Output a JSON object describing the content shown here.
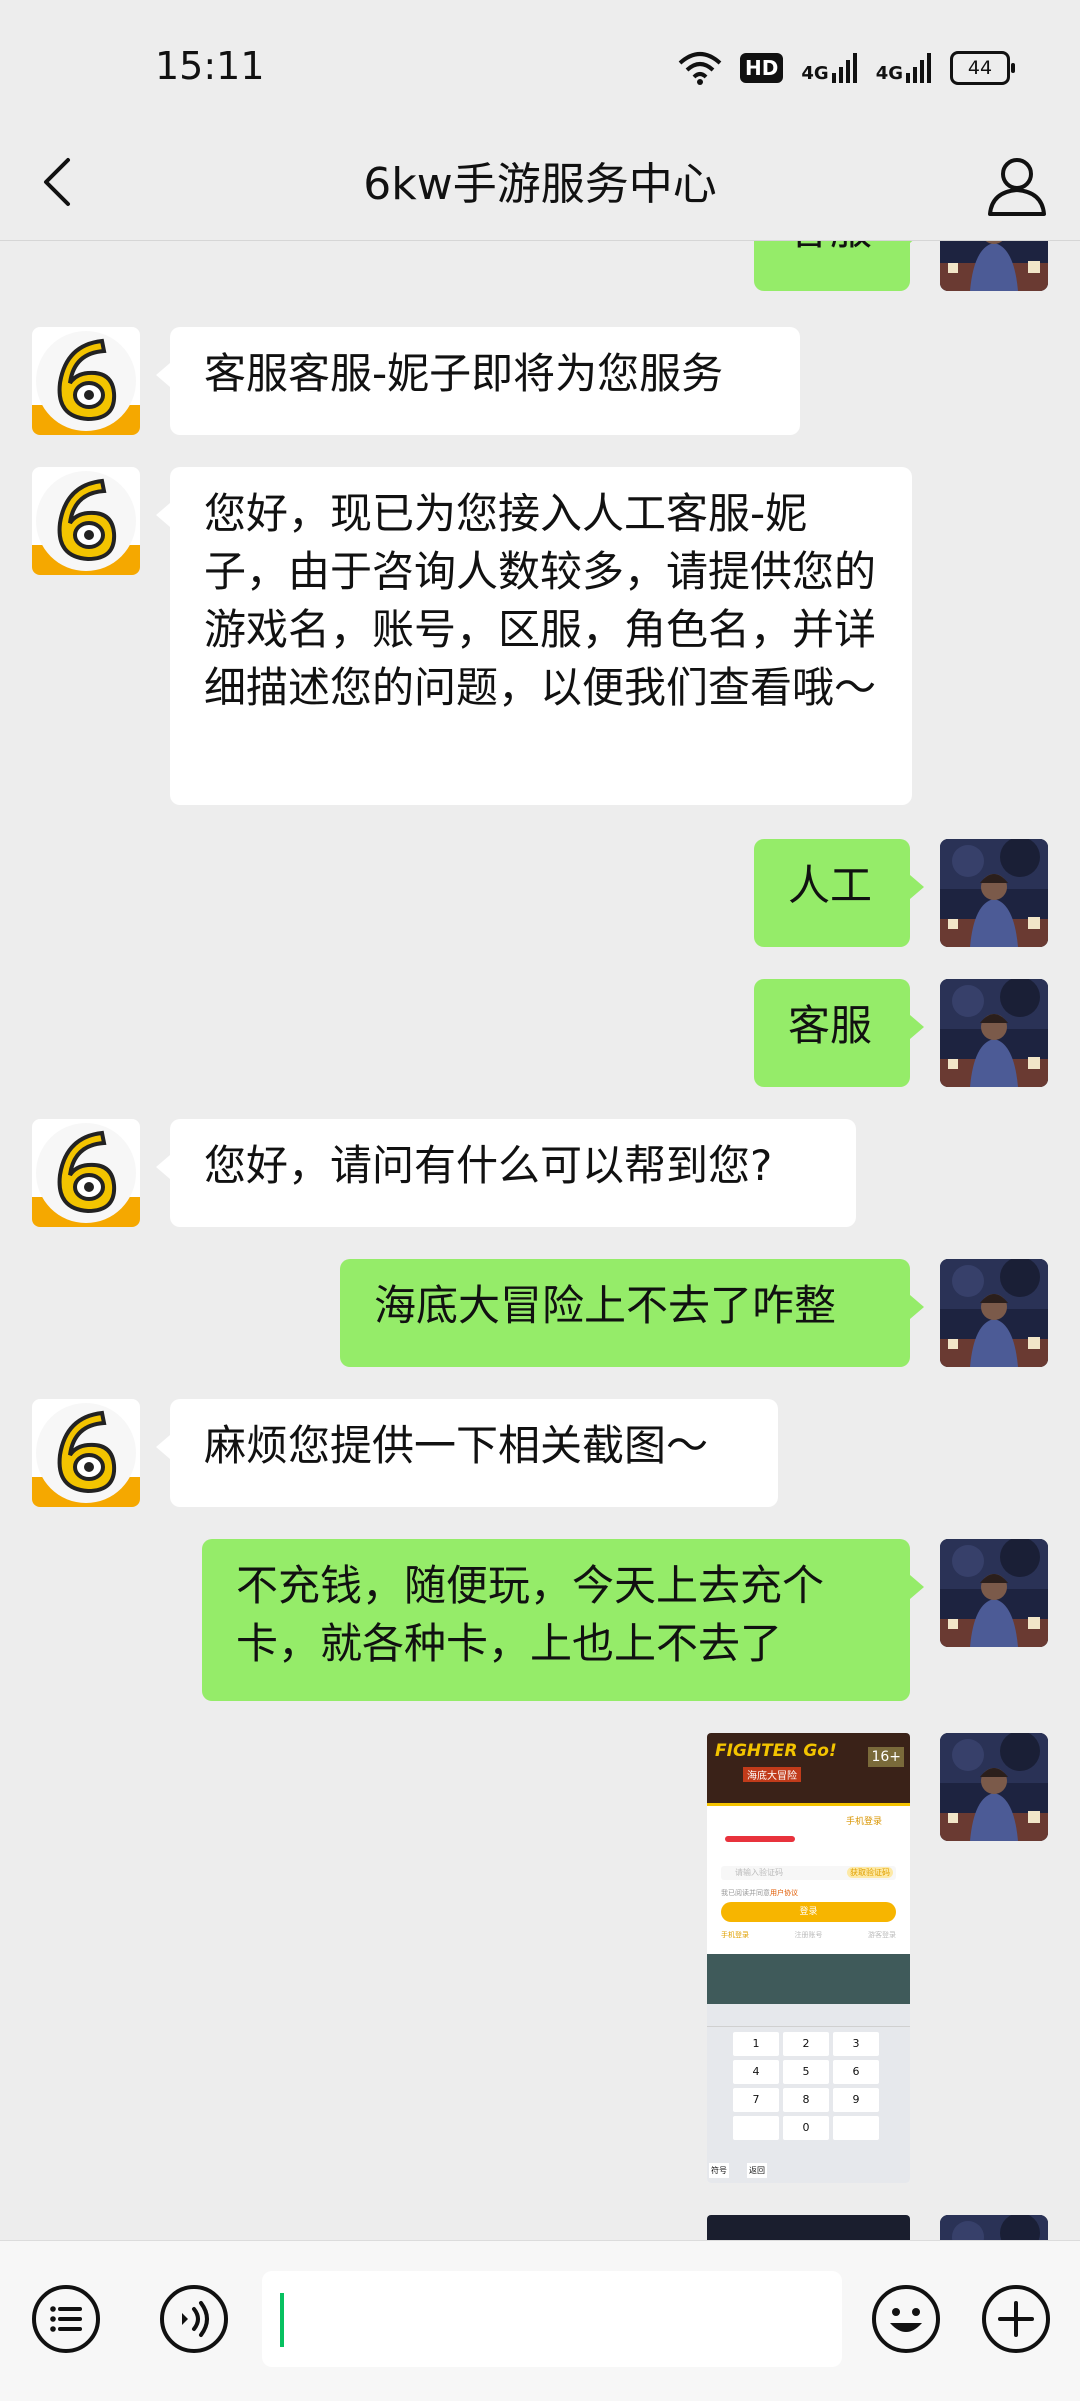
{
  "status_bar": {
    "time": "15:11",
    "hd_label": "HD",
    "network_1": "4G",
    "network_2": "4G",
    "battery": "44"
  },
  "header": {
    "title": "6kw手游服务中心"
  },
  "messages": [
    {
      "side": "out",
      "text": "客服"
    },
    {
      "side": "in",
      "text": "客服客服-妮子即将为您服务"
    },
    {
      "side": "in",
      "text": "您好，现已为您接入人工客服-妮子，由于咨询人数较多，请提供您的游戏名，账号，区服，角色名，并详细描述您的问题，以便我们查看哦～"
    },
    {
      "side": "out",
      "text": "人工"
    },
    {
      "side": "out",
      "text": "客服"
    },
    {
      "side": "in",
      "text": "您好，请问有什么可以帮到您?"
    },
    {
      "side": "out",
      "text": "海底大冒险上不去了咋整"
    },
    {
      "side": "in",
      "text": "麻烦您提供一下相关截图～"
    },
    {
      "side": "out",
      "text": "不充钱，随便玩，今天上去充个卡，就各种卡，上也上不去了"
    }
  ],
  "screenshot_thumb": {
    "game_title": "FIGHTER Go!",
    "game_subtitle": "海底大冒险",
    "age_badge": "16+",
    "login_header": "手机登录",
    "code_placeholder": "请输入验证码",
    "code_button": "获取验证码",
    "agree_text": "我已阅读并同意",
    "agree_link": "用户协议",
    "login_button": "登录",
    "links": [
      "手机登录",
      "注册账号",
      "游客登录"
    ],
    "keypad_keys": [
      "1",
      "2",
      "3",
      "4",
      "5",
      "6",
      "7",
      "8",
      "9",
      "0"
    ],
    "keypad_left": [
      "符号",
      "返回"
    ]
  },
  "input_bar": {
    "value": "",
    "icons": [
      "menu-icon",
      "voice-icon",
      "emoji-icon",
      "plus-icon"
    ]
  },
  "colors": {
    "background": "#ededed",
    "outgoing_bubble": "#95ec69",
    "incoming_bubble": "#ffffff",
    "accent": "#07c160"
  }
}
